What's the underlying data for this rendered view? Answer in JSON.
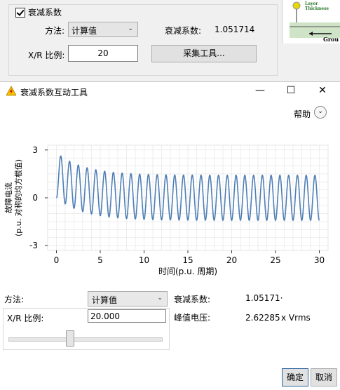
{
  "top_panel": {
    "group_title": "衰减系数",
    "method_label": "方法:",
    "method_value": "计算值",
    "decay_label": "衰减系数:",
    "decay_value": "1.051714",
    "xr_label": "X/R 比例:",
    "xr_value": "20",
    "collect_button": "采集工具..."
  },
  "preview": {
    "label_line1": "Layer",
    "label_line2": "Thickness",
    "ground_label": "Grou"
  },
  "dialog": {
    "title": "衰减系数互动工具",
    "help_label": "帮助",
    "method_label": "方法:",
    "method_value": "计算值",
    "xr_label": "X/R 比例:",
    "xr_value": "20.000",
    "slider_fraction": 0.4,
    "decay_label": "衰减系数:",
    "decay_value": "1.05171·",
    "peak_label": "峰值电压:",
    "peak_value": "2.62285",
    "peak_unit": "x Vrms",
    "ok_button": "确定",
    "cancel_button": "取消"
  },
  "chart_data": {
    "type": "line",
    "xlabel": "时间(p.u. 周期)",
    "ylabel": "故障电流\n(p.u. 对称的均方根值)",
    "xlim": [
      -1,
      31
    ],
    "ylim": [
      -3.3,
      3.3
    ],
    "x_ticks": [
      0,
      5,
      10,
      15,
      20,
      25,
      30
    ],
    "y_ticks": [
      -3,
      0,
      3
    ],
    "grid": true,
    "series": [
      {
        "x_start": 0,
        "x_end": 30,
        "amplitude": 1.414,
        "xr_ratio": 20,
        "color": "#4f7fb5"
      }
    ]
  },
  "colors": {
    "line": "#4f7fb5",
    "grid": "#e2e2e2",
    "accent": "#2d64a0"
  }
}
